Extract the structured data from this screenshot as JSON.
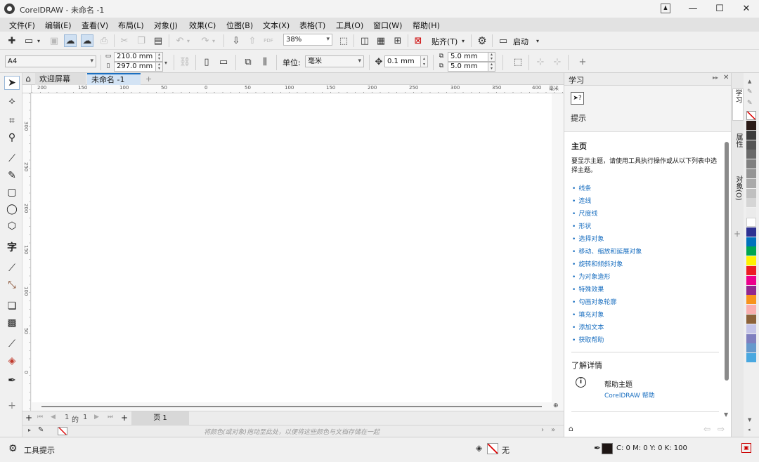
{
  "window": {
    "title": "CorelDRAW - 未命名 -1",
    "min": "—",
    "max": "☐",
    "close": "✕"
  },
  "menu": [
    "文件(F)",
    "编辑(E)",
    "查看(V)",
    "布局(L)",
    "对象(J)",
    "效果(C)",
    "位图(B)",
    "文本(X)",
    "表格(T)",
    "工具(O)",
    "窗口(W)",
    "帮助(H)"
  ],
  "toolbar": {
    "zoom": "38%",
    "snap_label": "贴齐(T)",
    "launch_label": "启动"
  },
  "props": {
    "paper": "A4",
    "width": "210.0 mm",
    "height": "297.0 mm",
    "unit_label": "单位:",
    "unit": "毫米",
    "nudge": "0.1 mm",
    "dup_x": "5.0 mm",
    "dup_y": "5.0 mm"
  },
  "tabs": {
    "welcome": "欢迎屏幕",
    "doc": "未命名 -1",
    "add": "+"
  },
  "ruler": {
    "h": [
      "200",
      "150",
      "100",
      "50",
      "0",
      "50",
      "100",
      "150",
      "200",
      "250",
      "300",
      "350",
      "400"
    ],
    "h_unit": "毫米",
    "v": [
      "300",
      "250",
      "200",
      "150",
      "100",
      "50",
      "0"
    ]
  },
  "pagenav": {
    "current": "1",
    "of": "的",
    "total": "1",
    "page_tab": "页 1"
  },
  "palette_hint": "将颜色(或对象)拖动至此处，以便将这些颜色与文档存储在一起",
  "docker": {
    "title": "学习",
    "tips_label": "提示",
    "home_title": "主页",
    "intro": "要显示主题，请使用工具执行操作或从以下列表中选择主题。",
    "links": [
      "线条",
      "连线",
      "尺度线",
      "形状",
      "选择对象",
      "移动、缩放和延展对象",
      "旋转和倾斜对象",
      "为对象造形",
      "特殊效果",
      "勾画对象轮廓",
      "填充对象",
      "添加文本",
      "获取帮助"
    ],
    "more_title": "了解详情",
    "help_title": "帮助主题",
    "help_link": "CorelDRAW 帮助"
  },
  "sidetabs": [
    "学习",
    "属性",
    "对象(O)"
  ],
  "swatches": [
    "#2b1b17",
    "#3c3c3c",
    "#555555",
    "#6a6a6a",
    "#808080",
    "#959595",
    "#aaaaaa",
    "#c0c0c0",
    "#d5d5d5",
    "#ebebeb",
    "#ffffff",
    "#2e3192",
    "#0072bc",
    "#00a651",
    "#fff200",
    "#ed1c24",
    "#ec008c",
    "#92278f",
    "#f7941d",
    "#f9aeae",
    "#8c6239",
    "#c4c4e8",
    "#7f7fbf",
    "#6699cc",
    "#4aa8e0"
  ],
  "status": {
    "hint": "工具提示",
    "fill_none": "无",
    "outline": "C: 0 M: 0 Y: 0 K: 100"
  }
}
